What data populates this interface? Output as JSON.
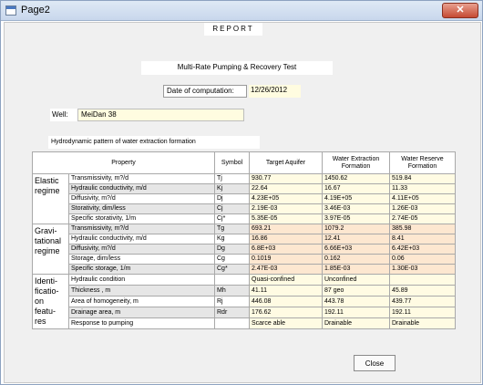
{
  "window": {
    "title": "Page2",
    "close_glyph": "✕"
  },
  "report": {
    "heading": "REPORT",
    "test_title": "Multi-Rate Pumping & Recovery Test",
    "date_label": "Date of computation:",
    "date_value": "12/26/2012",
    "well_label": "Well:",
    "well_value": "MeiDan 38",
    "section_caption": "Hydrodynamic pattern of water extraction formation"
  },
  "table": {
    "headers": {
      "property": "Property",
      "symbol": "Symbol",
      "target": "Target Aquifer",
      "extraction": "Water Extraction Formation",
      "reserve": "Water Reserve Formation"
    },
    "groups": {
      "elastic": "Elastic regime",
      "gravitational": "Gravi-tational regime",
      "identification": "Identi-ficatio-on featu-res"
    },
    "rows": [
      {
        "property": "Transmissivity, m?/d",
        "symbol": "Tj",
        "target": "930.77",
        "extraction": "1450.62",
        "reserve": "519.84"
      },
      {
        "property": "Hydraulic conductivity, m/d",
        "symbol": "Kj",
        "target": "22.64",
        "extraction": "16.67",
        "reserve": "11.33"
      },
      {
        "property": "Diffusivity, m?/d",
        "symbol": "Dj",
        "target": "4.23E+05",
        "extraction": "4.19E+05",
        "reserve": "4.11E+05"
      },
      {
        "property": "Storativity, dim/less",
        "symbol": "Cj",
        "target": "2.19E-03",
        "extraction": "3.46E-03",
        "reserve": "1.26E-03"
      },
      {
        "property": "Specific storativity, 1/m",
        "symbol": "Cj*",
        "target": "5.35E-05",
        "extraction": "3.97E-05",
        "reserve": "2.74E-05"
      },
      {
        "property": "Transmissivity, m?/d",
        "symbol": "Tg",
        "target": "693.21",
        "extraction": "1079.2",
        "reserve": "385.98"
      },
      {
        "property": "Hydraulic conductivity, m/d",
        "symbol": "Kg",
        "target": "16.86",
        "extraction": "12.41",
        "reserve": "8.41"
      },
      {
        "property": "Diffusivity, m?/d",
        "symbol": "Dg",
        "target": "6.8E+03",
        "extraction": "6.66E+03",
        "reserve": "6.42E+03"
      },
      {
        "property": "Storage, dim/less",
        "symbol": "Cg",
        "target": "0.1019",
        "extraction": "0.162",
        "reserve": "0.06"
      },
      {
        "property": "Specific storage, 1/m",
        "symbol": "Cg*",
        "target": "2.47E-03",
        "extraction": "1.85E-03",
        "reserve": "1.30E-03"
      },
      {
        "property": "Hydraulic condition",
        "symbol": "",
        "target": "Quasi-confined",
        "extraction": "Unconfined",
        "reserve": ""
      },
      {
        "property": "Thickness , m",
        "symbol": "Mh",
        "target": "41.11",
        "extraction": "87 geo",
        "reserve": "45.89"
      },
      {
        "property": "Area of homogeneity, m",
        "symbol": "Rj",
        "target": "446.08",
        "extraction": "443.78",
        "reserve": "439.77"
      },
      {
        "property": "Drainage area, m",
        "symbol": "Rdr",
        "target": "176.62",
        "extraction": "192.11",
        "reserve": "192.11"
      },
      {
        "property": "Response to pumping",
        "symbol": "",
        "target": "Scarce able",
        "extraction": "Drainable",
        "reserve": "Drainable"
      }
    ]
  },
  "buttons": {
    "close_label": "Close"
  }
}
